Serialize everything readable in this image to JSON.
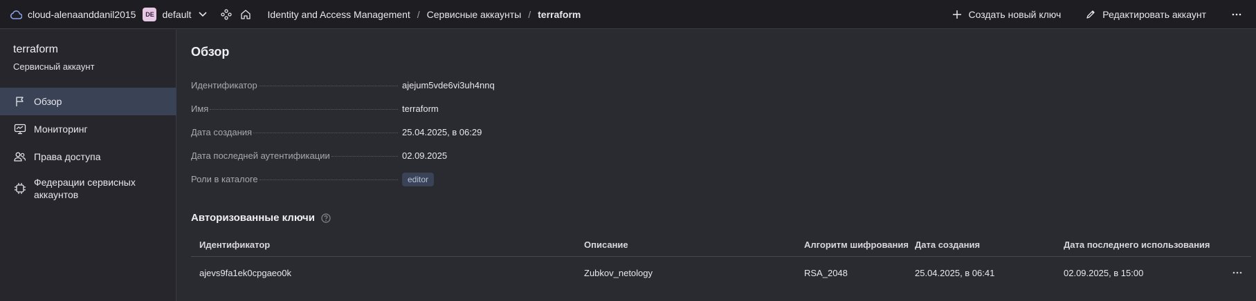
{
  "topbar": {
    "cloud_name": "cloud-alenaanddanil2015",
    "folder_badge": "DE",
    "folder_name": "default",
    "breadcrumbs": [
      "Identity and Access Management",
      "Сервисные аккаунты",
      "terraform"
    ],
    "create_key_label": "Создать новый ключ",
    "edit_account_label": "Редактировать аккаунт"
  },
  "sidebar": {
    "title": "terraform",
    "subtitle": "Сервисный аккаунт",
    "items": [
      {
        "label": "Обзор",
        "icon": "flag-icon",
        "active": true
      },
      {
        "label": "Мониторинг",
        "icon": "monitor-icon",
        "active": false
      },
      {
        "label": "Права доступа",
        "icon": "users-icon",
        "active": false
      },
      {
        "label": "Федерации сервисных аккаунтов",
        "icon": "chip-icon",
        "active": false
      }
    ]
  },
  "overview": {
    "heading": "Обзор",
    "properties": [
      {
        "key": "Идентификатор",
        "value": "ajejum5vde6vi3uh4nnq"
      },
      {
        "key": "Имя",
        "value": "terraform"
      },
      {
        "key": "Дата создания",
        "value": "25.04.2025, в 06:29"
      },
      {
        "key": "Дата последней аутентификации",
        "value": "02.09.2025"
      },
      {
        "key": "Роли в каталоге",
        "value": "editor"
      }
    ]
  },
  "keys": {
    "heading": "Авторизованные ключи",
    "columns": [
      "Идентификатор",
      "Описание",
      "Алгоритм шифрования",
      "Дата создания",
      "Дата последнего использования"
    ],
    "rows": [
      [
        "ajevs9fa1ek0cpgaeo0k",
        "Zubkov_netology",
        "RSA_2048",
        "25.04.2025, в 06:41",
        "02.09.2025, в 15:00"
      ]
    ]
  },
  "colors": {
    "topbar_bg": "#1d1d22",
    "page_bg": "#2a2a31",
    "active_nav_bg": "#3a4255",
    "accent": "#8aa4e8"
  }
}
